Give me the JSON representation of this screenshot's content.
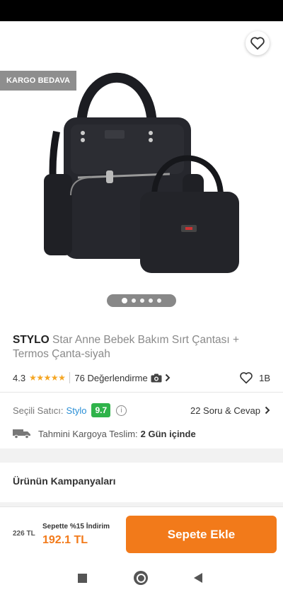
{
  "badge": {
    "free_shipping": "KARGO BEDAVA"
  },
  "gallery": {
    "dot_count": 5,
    "active_index": 0
  },
  "product": {
    "brand": "STYLO",
    "name": "Star Anne Bebek Bakım Sırt Çantası + Termos Çanta-siyah",
    "rating": "4.3",
    "rating_value": 4.3,
    "stars": "★★★★★",
    "reviews": "76 Değerlendirme",
    "favorites": "1B"
  },
  "seller": {
    "label": "Seçili Satıcı:",
    "name": "Stylo",
    "score": "9.7",
    "qa": "22 Soru & Cevap"
  },
  "delivery": {
    "label": "Tahmini Kargoya Teslim:",
    "value": "2 Gün içinde"
  },
  "campaigns": {
    "title": "Ürünün Kampanyaları"
  },
  "purchase": {
    "old_price": "226 TL",
    "promo": "Sepette %15 İndirim",
    "price": "192.1 TL",
    "button": "Sepete Ekle"
  },
  "colors": {
    "accent": "#f27a1a",
    "seller_score": "#2fb34a",
    "link": "#2a8fd6",
    "star": "#f5a623"
  }
}
